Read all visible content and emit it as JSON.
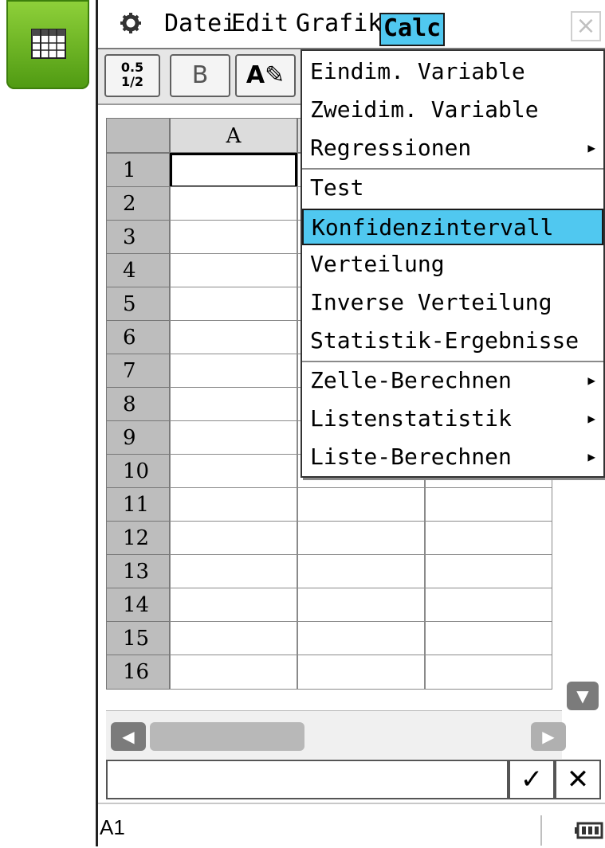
{
  "menubar": {
    "items": [
      "Datei",
      "Edit",
      "Grafik",
      "Calc"
    ],
    "active": "Calc",
    "close_label": "×"
  },
  "toolbar": {
    "fraction_top": "0.5",
    "fraction_bottom": "1/2",
    "bold_label": "B",
    "format_label": "A✎"
  },
  "grid": {
    "columns": [
      "A"
    ],
    "rows": [
      "1",
      "2",
      "3",
      "4",
      "5",
      "6",
      "7",
      "8",
      "9",
      "10",
      "11",
      "12",
      "13",
      "14",
      "15",
      "16"
    ],
    "selected_cell": "A1"
  },
  "dropdown": {
    "items": [
      {
        "label": "Eindim. Variable",
        "submenu": false
      },
      {
        "label": "Zweidim. Variable",
        "submenu": false
      },
      {
        "label": "Regressionen",
        "submenu": true
      },
      {
        "label": "Test",
        "submenu": false
      },
      {
        "label": "Konfidenzintervall",
        "submenu": false,
        "selected": true
      },
      {
        "label": "Verteilung",
        "submenu": false
      },
      {
        "label": "Inverse Verteilung",
        "submenu": false
      },
      {
        "label": "Statistik-Ergebnisse",
        "submenu": false
      },
      {
        "label": "Zelle-Berechnen",
        "submenu": true
      },
      {
        "label": "Listenstatistik",
        "submenu": true
      },
      {
        "label": "Liste-Berechnen",
        "submenu": true
      }
    ]
  },
  "entry": {
    "ok_label": "✓",
    "cancel_label": "✕"
  },
  "status": {
    "cell_ref": "A1"
  },
  "colors": {
    "accent": "#50c8f0",
    "app_icon": "#6cb526"
  }
}
